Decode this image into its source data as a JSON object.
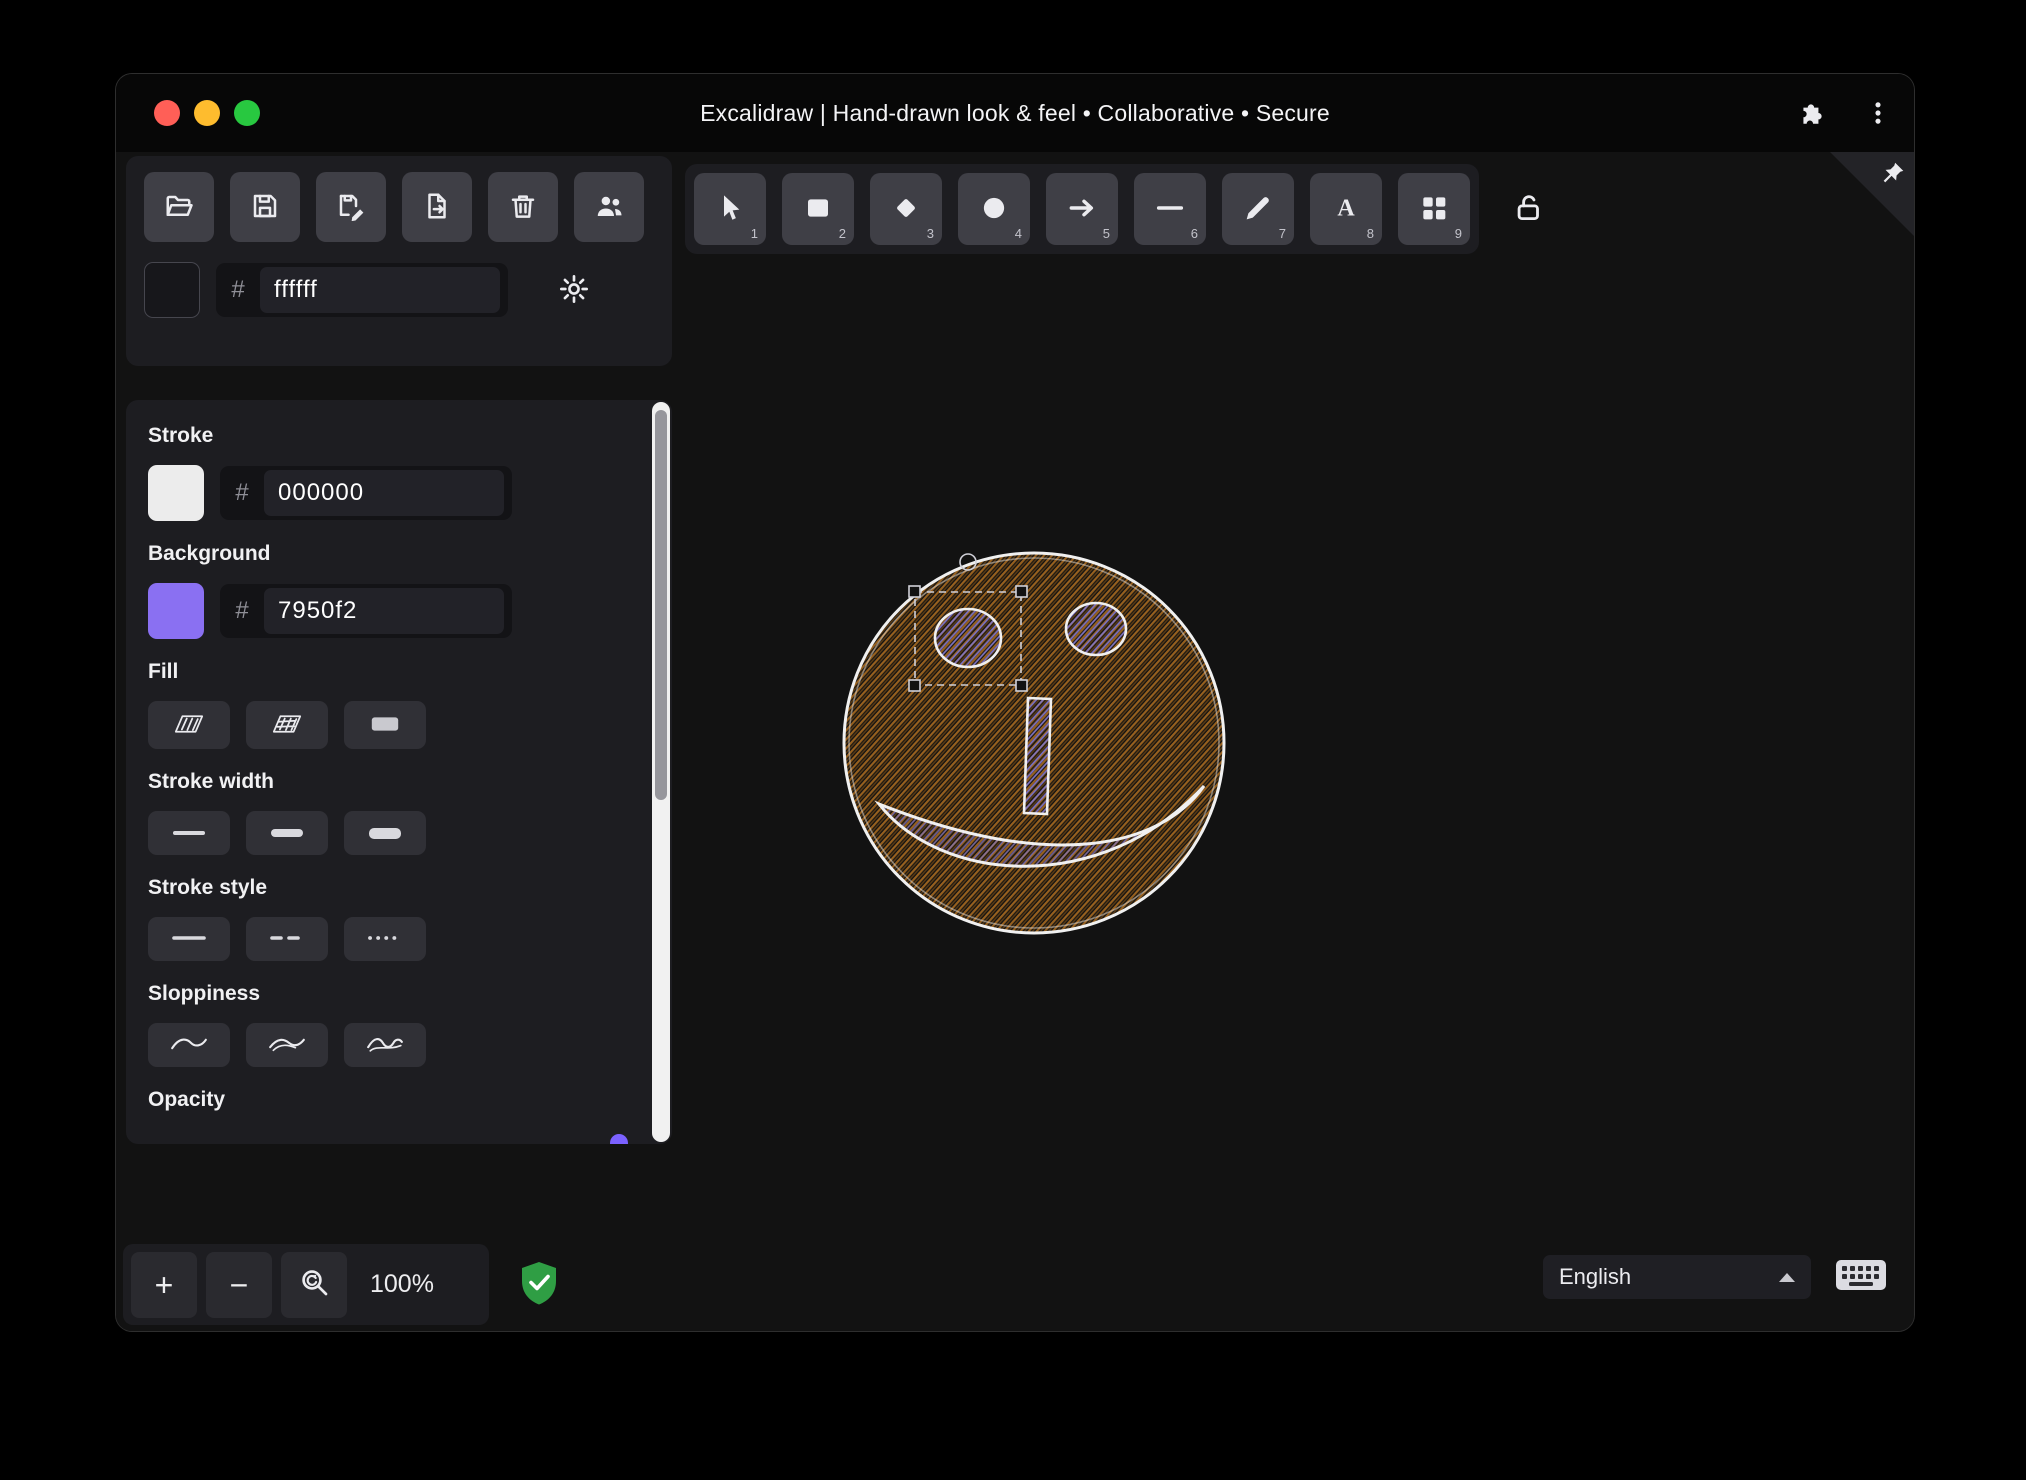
{
  "window": {
    "title": "Excalidraw | Hand-drawn look & feel • Collaborative • Secure"
  },
  "titlebar_icons": [
    {
      "name": "extensions",
      "icon": "puzzle-icon"
    },
    {
      "name": "menu",
      "icon": "kebab-menu-icon"
    }
  ],
  "file_toolbar": [
    {
      "name": "open",
      "icon": "folder-open-icon"
    },
    {
      "name": "save",
      "icon": "save-icon"
    },
    {
      "name": "save-as",
      "icon": "save-as-icon"
    },
    {
      "name": "export",
      "icon": "export-file-icon"
    },
    {
      "name": "reset-canvas",
      "icon": "trash-icon"
    },
    {
      "name": "collaboration",
      "icon": "users-icon"
    }
  ],
  "canvas_background": {
    "hash": "#",
    "value": "ffffff",
    "swatch_color": "#17171b",
    "settings_icon": "gear-icon"
  },
  "tools": {
    "items": [
      {
        "name": "selection",
        "icon": "cursor-icon",
        "shortcut": "1"
      },
      {
        "name": "rectangle",
        "icon": "rectangle-icon",
        "shortcut": "2"
      },
      {
        "name": "diamond",
        "icon": "diamond-icon",
        "shortcut": "3"
      },
      {
        "name": "ellipse",
        "icon": "ellipse-icon",
        "shortcut": "4"
      },
      {
        "name": "arrow",
        "icon": "arrow-icon",
        "shortcut": "5"
      },
      {
        "name": "line",
        "icon": "line-icon",
        "shortcut": "6"
      },
      {
        "name": "draw",
        "icon": "pencil-icon",
        "shortcut": "7"
      },
      {
        "name": "text",
        "icon": "text-icon",
        "shortcut": "8"
      },
      {
        "name": "shapes",
        "icon": "shapes-grid-icon",
        "shortcut": "9"
      }
    ],
    "lock": {
      "name": "keep-tool-active",
      "icon": "unlock-icon"
    }
  },
  "properties_panel": {
    "stroke": {
      "label": "Stroke",
      "hash": "#",
      "value": "000000",
      "swatch_color": "#ececec"
    },
    "background": {
      "label": "Background",
      "hash": "#",
      "value": "7950f2",
      "swatch_color": "#8a70f2"
    },
    "fill": {
      "label": "Fill",
      "options": [
        {
          "name": "hachure"
        },
        {
          "name": "cross-hatch"
        },
        {
          "name": "solid"
        }
      ]
    },
    "stroke_width": {
      "label": "Stroke width",
      "options": [
        {
          "name": "thin"
        },
        {
          "name": "bold"
        },
        {
          "name": "extra-bold"
        }
      ]
    },
    "stroke_style": {
      "label": "Stroke style",
      "options": [
        {
          "name": "solid"
        },
        {
          "name": "dashed"
        },
        {
          "name": "dotted"
        }
      ]
    },
    "sloppiness": {
      "label": "Sloppiness",
      "options": [
        {
          "name": "architect"
        },
        {
          "name": "artist"
        },
        {
          "name": "cartoonist"
        }
      ]
    },
    "opacity": {
      "label": "Opacity"
    }
  },
  "canvas": {
    "drawing": "hand-drawn smiley face with one eye selected",
    "face_hatch_color": "#96601f",
    "feature_hatch_color": "#7d74c9",
    "outline_color": "#f0f0f0",
    "selection_color": "#d0d0d8"
  },
  "footer": {
    "zoom_in": "+",
    "zoom_out": "−",
    "zoom_level": "100%",
    "reset_zoom_icon": "magnifier-reset-icon",
    "encryption_icon": "shield-check-icon",
    "shield_color": "#2f9e44",
    "language": {
      "value": "English"
    },
    "keyboard_icon": "keyboard-icon"
  }
}
